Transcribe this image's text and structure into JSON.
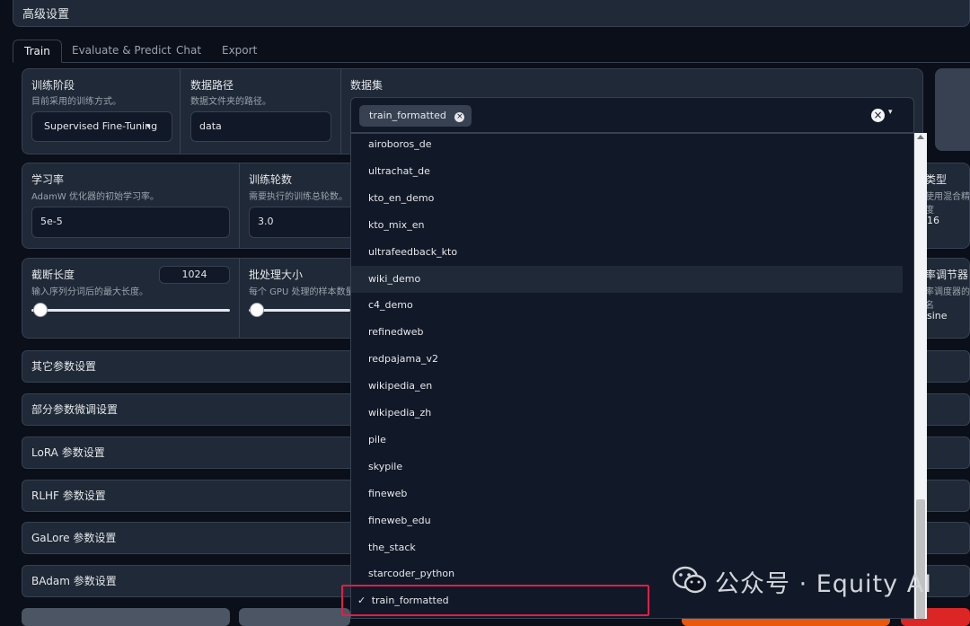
{
  "header": {
    "title": "高级设置"
  },
  "tabs": [
    "Train",
    "Evaluate & Predict",
    "Chat",
    "Export"
  ],
  "training_stage": {
    "label": "训练阶段",
    "desc": "目前采用的训练方式。",
    "value": "Supervised Fine-Tuning"
  },
  "data_path": {
    "label": "数据路径",
    "desc": "数据文件夹的路径。",
    "value": "data"
  },
  "dataset": {
    "label": "数据集",
    "selected_chip": "train_formatted"
  },
  "learning_rate": {
    "label": "学习率",
    "desc": "AdamW 优化器的初始学习率。",
    "value": "5e-5"
  },
  "epochs": {
    "label": "训练轮数",
    "desc": "需要执行的训练总轮数。",
    "value": "3.0"
  },
  "cutoff": {
    "label": "截断长度",
    "desc": "输入序列分词后的最大长度。",
    "value": "1024"
  },
  "batch": {
    "label": "批处理大小",
    "desc": "每个 GPU 处理的样本数量"
  },
  "right_partial": {
    "type_label": "类型",
    "type_desc": "使用混合精度",
    "type_value": "16",
    "sched_label": "率调节器",
    "sched_desc": "率调度器的名",
    "sched_value": "sine"
  },
  "accordions": [
    "其它参数设置",
    "部分参数微调设置",
    "LoRA 参数设置",
    "RLHF 参数设置",
    "GaLore 参数设置",
    "BAdam 参数设置"
  ],
  "dropdown_options": [
    "airoboros_de",
    "ultrachat_de",
    "kto_en_demo",
    "kto_mix_en",
    "ultrafeedback_kto",
    "wiki_demo",
    "c4_demo",
    "refinedweb",
    "redpajama_v2",
    "wikipedia_en",
    "wikipedia_zh",
    "pile",
    "skypile",
    "fineweb",
    "fineweb_edu",
    "the_stack",
    "starcoder_python",
    "train_formatted"
  ],
  "hovered_option": "wiki_demo",
  "checked_option": "train_formatted",
  "checkmark": "✓",
  "chip_close": "×",
  "clear_symbol": "×",
  "caret_symbol": "▾",
  "watermark": "公众号 · Equity AI",
  "colors": {
    "background": "#0b0f19",
    "panel": "#1f2937",
    "border": "#374151",
    "highlight_box": "#e11d48",
    "orange_button": "#ea580c"
  }
}
